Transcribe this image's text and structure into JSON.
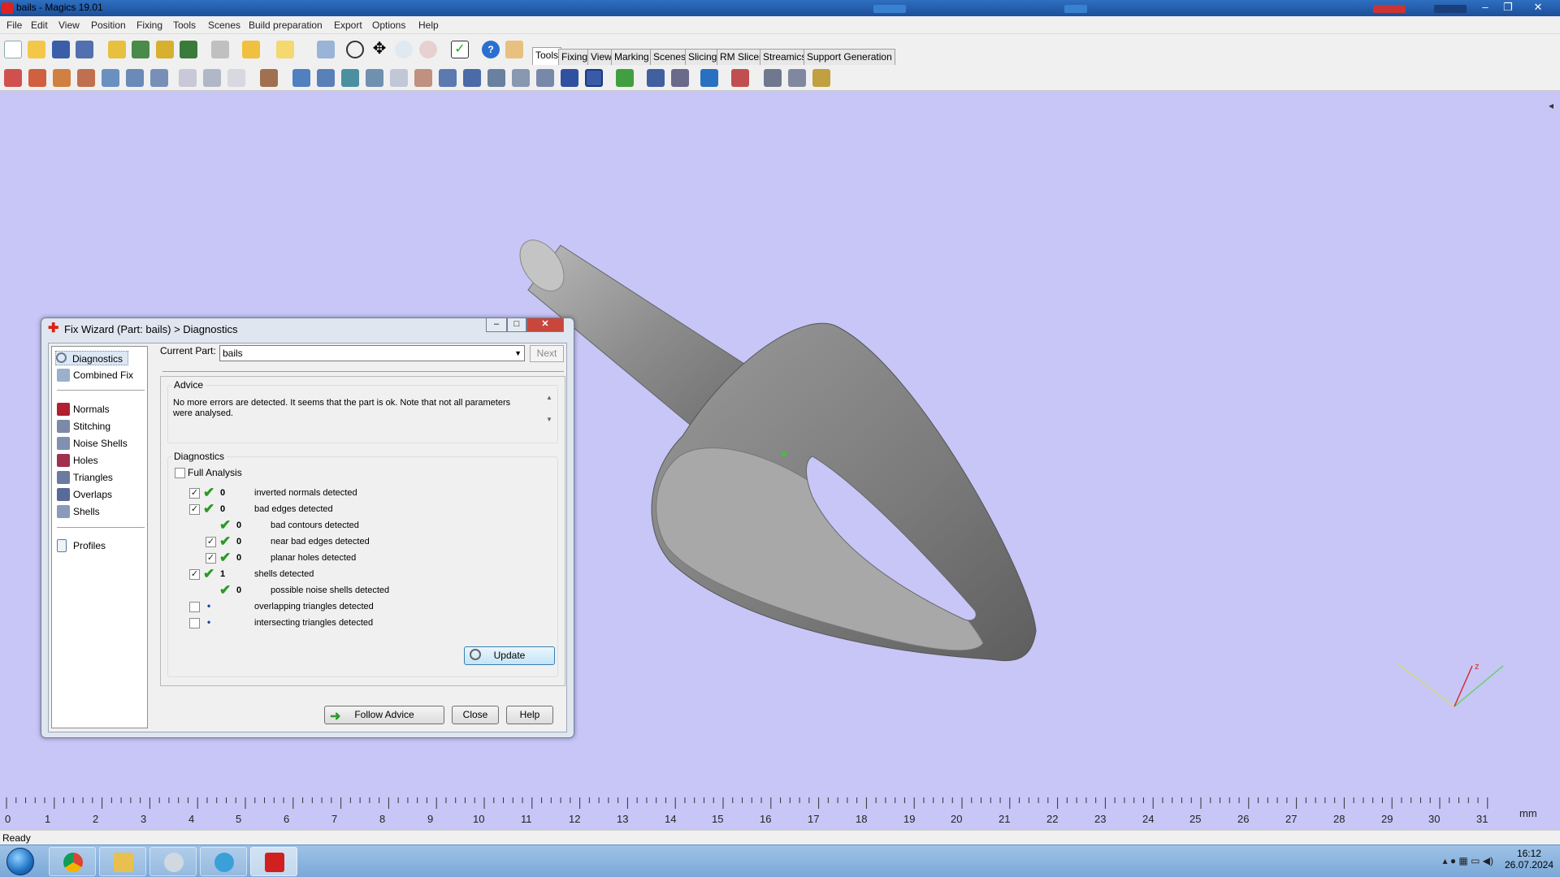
{
  "window": {
    "title": "bails - Magics 19.01"
  },
  "menu": [
    "File",
    "Edit",
    "View",
    "Position",
    "Fixing",
    "Tools",
    "Scenes",
    "Build preparation",
    "Export",
    "Options",
    "Help"
  ],
  "tabs": [
    "Tools",
    "Fixing",
    "View",
    "Marking",
    "Scenes",
    "Slicing",
    "RM Slicer",
    "Streamics",
    "Support Generation"
  ],
  "active_tab": "Tools",
  "dialog": {
    "title": "Fix Wizard (Part: bails) > Diagnostics",
    "nav": {
      "top": [
        "Diagnostics",
        "Combined Fix"
      ],
      "tools": [
        "Normals",
        "Stitching",
        "Noise Shells",
        "Holes",
        "Triangles",
        "Overlaps",
        "Shells"
      ],
      "bottom": [
        "Profiles"
      ]
    },
    "current_part_label": "Current Part:",
    "current_part_value": "bails",
    "next_label": "Next",
    "advice_title": "Advice",
    "advice_text": "No more errors are detected. It seems that the part is ok. Note that not all parameters were analysed.",
    "diagnostics_title": "Diagnostics",
    "full_analysis_label": "Full Analysis",
    "rows": [
      {
        "count": "0",
        "label": "inverted normals detected"
      },
      {
        "count": "0",
        "label": "bad edges detected"
      },
      {
        "count": "0",
        "label": "bad contours detected"
      },
      {
        "count": "0",
        "label": "near bad edges detected"
      },
      {
        "count": "0",
        "label": "planar holes detected"
      },
      {
        "count": "1",
        "label": "shells detected"
      },
      {
        "count": "0",
        "label": "possible noise shells detected"
      },
      {
        "count": "•",
        "label": "overlapping triangles detected"
      },
      {
        "count": "•",
        "label": "intersecting triangles detected"
      }
    ],
    "update_label": "Update",
    "follow_advice_label": "Follow Advice",
    "close_label": "Close",
    "help_label": "Help"
  },
  "ruler": {
    "unit": "mm",
    "ticks": [
      "0",
      "1",
      "2",
      "3",
      "4",
      "5",
      "6",
      "7",
      "8",
      "9",
      "10",
      "11",
      "12",
      "13",
      "14",
      "15",
      "16",
      "17",
      "18",
      "19",
      "20",
      "21",
      "22",
      "23",
      "24",
      "25",
      "26",
      "27",
      "28",
      "29",
      "30",
      "31"
    ]
  },
  "status": "Ready",
  "clock": {
    "time": "16:12",
    "date": "26.07.2024"
  },
  "colors": {
    "viewport": "#c7c6f7",
    "model": "#8c8c8c",
    "check": "#2b9a23"
  }
}
